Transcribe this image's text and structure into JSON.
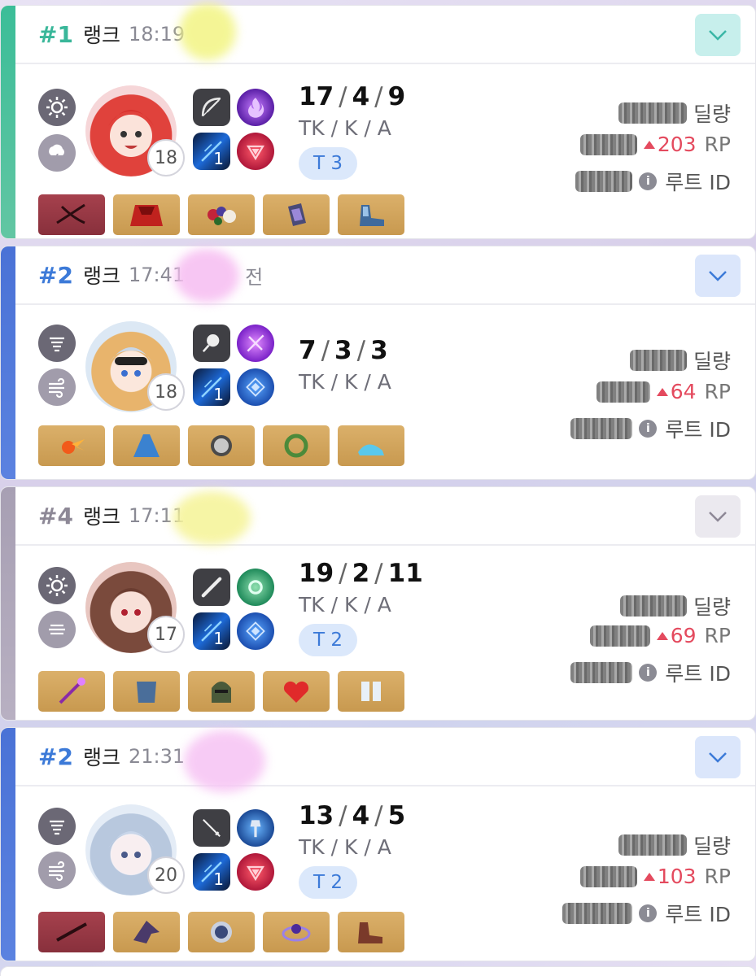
{
  "matches": [
    {
      "rank": "#1",
      "rank_color": "#3ab79a",
      "stripe_color": "#3bbd98",
      "mode": "랭크",
      "time": "18:19",
      "time_suffix": "",
      "expand_btn_bg": "#c7efec",
      "expand_icon_color": "#3ab6a6",
      "weather_icons": [
        "sun-icon",
        "thunderstorm-icon"
      ],
      "character_level": "18",
      "portrait_colors": [
        "#f6d6d8",
        "#e0423c"
      ],
      "skills": [
        "bow-icon",
        "purple-flame-icon",
        "weapon-skill-icon",
        "red-triangle-icon"
      ],
      "weapon_skill_level": "1",
      "kda": {
        "tk": "17",
        "k": "4",
        "a": "9"
      },
      "kda_label": "TK / K / A",
      "tier": "T 3",
      "items": [
        {
          "icon": "crossbow-icon",
          "bg": "red"
        },
        {
          "icon": "red-cloak-icon",
          "bg": "gold"
        },
        {
          "icon": "flower-crown-icon",
          "bg": "gold"
        },
        {
          "icon": "gauntlet-icon",
          "bg": "gold"
        },
        {
          "icon": "armored-boots-icon",
          "bg": "gold"
        }
      ],
      "damage_label": "딜량",
      "rp_value": "203",
      "rp_label": "RP",
      "root_id_label": "루트 ID"
    },
    {
      "rank": "#2",
      "rank_color": "#3c7ad8",
      "stripe_color": "#4a72d6",
      "mode": "랭크",
      "time": "17:41",
      "time_suffix": "전",
      "expand_btn_bg": "#dbe6fb",
      "expand_icon_color": "#3c7ad8",
      "weather_icons": [
        "fog-icon",
        "wind-icon"
      ],
      "character_level": "18",
      "portrait_colors": [
        "#dce8f4",
        "#e8b46c"
      ],
      "skills": [
        "magnifier-icon",
        "violet-burst-icon",
        "weapon-skill-icon",
        "blue-crest-icon"
      ],
      "weapon_skill_level": "1",
      "kda": {
        "tk": "7",
        "k": "3",
        "a": "3"
      },
      "kda_label": "TK / K / A",
      "tier": "",
      "items": [
        {
          "icon": "fireball-icon",
          "bg": "gold"
        },
        {
          "icon": "blue-dress-icon",
          "bg": "gold"
        },
        {
          "icon": "helmet-icon",
          "bg": "gold"
        },
        {
          "icon": "green-ring-icon",
          "bg": "gold"
        },
        {
          "icon": "glass-heels-icon",
          "bg": "gold"
        }
      ],
      "damage_label": "딜량",
      "rp_value": "64",
      "rp_label": "RP",
      "root_id_label": "루트 ID"
    },
    {
      "rank": "#4",
      "rank_color": "#8d8896",
      "stripe_color": "#a79fb3",
      "mode": "랭크",
      "time": "17:11",
      "time_suffix": "",
      "expand_btn_bg": "#ebe9ef",
      "expand_icon_color": "#8d8896",
      "weather_icons": [
        "sun-icon",
        "haze-icon"
      ],
      "character_level": "17",
      "portrait_colors": [
        "#e8c6c0",
        "#7a4a3c"
      ],
      "skills": [
        "bat-icon",
        "green-ring-skill-icon",
        "weapon-skill-icon",
        "blue-crest-icon"
      ],
      "weapon_skill_level": "1",
      "kda": {
        "tk": "19",
        "k": "2",
        "a": "11"
      },
      "kda_label": "TK / K / A",
      "tier": "T 2",
      "items": [
        {
          "icon": "scepter-icon",
          "bg": "gold"
        },
        {
          "icon": "blue-armor-icon",
          "bg": "gold"
        },
        {
          "icon": "knight-helm-icon",
          "bg": "gold"
        },
        {
          "icon": "flame-heart-icon",
          "bg": "gold"
        },
        {
          "icon": "white-boots-icon",
          "bg": "gold"
        }
      ],
      "damage_label": "딜량",
      "rp_value": "69",
      "rp_label": "RP",
      "root_id_label": "루트 ID"
    },
    {
      "rank": "#2",
      "rank_color": "#3c7ad8",
      "stripe_color": "#4a72d6",
      "mode": "랭크",
      "time": "21:31",
      "time_suffix": "",
      "expand_btn_bg": "#dbe6fb",
      "expand_icon_color": "#3c7ad8",
      "weather_icons": [
        "fog-icon",
        "wind-icon"
      ],
      "character_level": "20",
      "portrait_colors": [
        "#e4ecf6",
        "#b8c8de"
      ],
      "skills": [
        "rapier-icon",
        "axe-skill-icon",
        "weapon-skill-icon",
        "red-triangle-icon"
      ],
      "weapon_skill_level": "1",
      "kda": {
        "tk": "13",
        "k": "4",
        "a": "5"
      },
      "kda_label": "TK / K / A",
      "tier": "T 2",
      "items": [
        {
          "icon": "rifle-icon",
          "bg": "red"
        },
        {
          "icon": "dark-wing-icon",
          "bg": "gold"
        },
        {
          "icon": "space-helmet-icon",
          "bg": "gold"
        },
        {
          "icon": "orb-bracelet-icon",
          "bg": "gold"
        },
        {
          "icon": "combat-boots-icon",
          "bg": "gold"
        }
      ],
      "damage_label": "딜량",
      "rp_value": "103",
      "rp_label": "RP",
      "root_id_label": "루트 ID"
    }
  ]
}
